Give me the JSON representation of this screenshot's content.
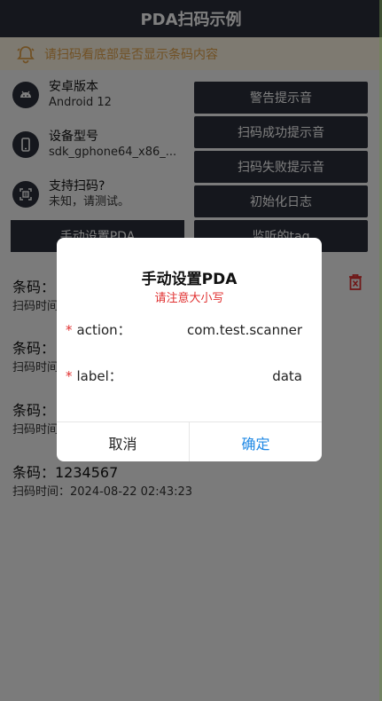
{
  "header": {
    "title": "PDA扫码示例"
  },
  "notice": {
    "text": "请扫码看底部是否显示条码内容"
  },
  "info": [
    {
      "label": "安卓版本",
      "value": "Android 12"
    },
    {
      "label": "设备型号",
      "value": "sdk_gphone64_x86_..."
    },
    {
      "label": "支持扫码?",
      "value": "未知，请测试。"
    }
  ],
  "buttons": {
    "warn": "警告提示音",
    "success": "扫码成功提示音",
    "fail": "扫码失败提示音",
    "init_log": "初始化日志",
    "manual": "手动设置PDA",
    "listen": "监听的tag"
  },
  "records": [
    {
      "code": "条码：",
      "time": "扫码时间"
    },
    {
      "code": "条码：",
      "time": "扫码时间"
    },
    {
      "code": "条码：",
      "time": "扫码时间"
    },
    {
      "code": "条码：1234567",
      "time": "扫码时间：2024-08-22 02:43:23"
    }
  ],
  "dialog": {
    "title": "手动设置PDA",
    "subtitle": "请注意大小写",
    "fields": [
      {
        "required": "*",
        "label": "action：",
        "value": "com.test.scanner"
      },
      {
        "required": "*",
        "label": "label：",
        "value": "data"
      }
    ],
    "cancel": "取消",
    "confirm": "确定"
  },
  "colors": {
    "header_bg": "#2b2f3a",
    "accent_red": "#e03030",
    "confirm_blue": "#1e88e5",
    "notice_text": "#e2a34b",
    "notice_bg": "#fcf4e2"
  }
}
